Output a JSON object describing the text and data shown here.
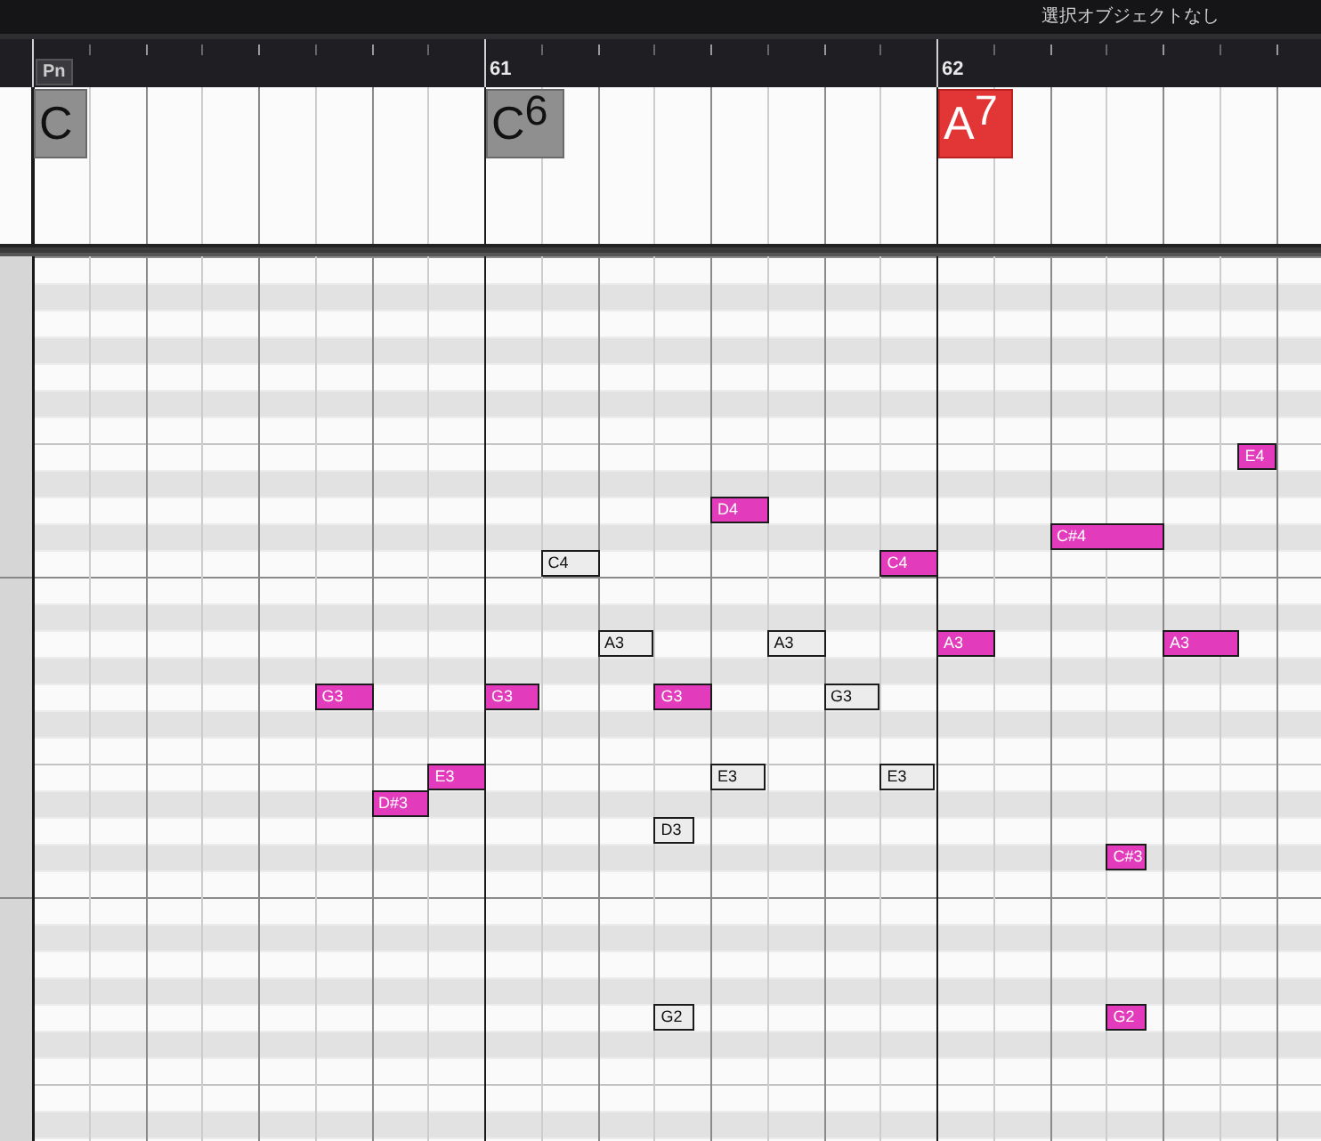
{
  "toolbar": {
    "status_text": "選択オブジェクトなし"
  },
  "ruler": {
    "marker": "Pn",
    "bars": [
      {
        "label": "61"
      },
      {
        "label": "62"
      }
    ]
  },
  "chord_track": {
    "chords": [
      {
        "label": "C",
        "selected": false
      },
      {
        "label": "C$^{6}$",
        "selected": false
      },
      {
        "label": "A$^{7}$",
        "selected": true
      }
    ]
  },
  "notes": [
    {
      "label": "E4",
      "selected": true
    },
    {
      "label": "D4",
      "selected": true
    },
    {
      "label": "C#4",
      "selected": true
    },
    {
      "label": "C4",
      "selected": false
    },
    {
      "label": "C4",
      "selected": true
    },
    {
      "label": "A3",
      "selected": false
    },
    {
      "label": "A3",
      "selected": false
    },
    {
      "label": "A3",
      "selected": true
    },
    {
      "label": "A3",
      "selected": true
    },
    {
      "label": "G3",
      "selected": true
    },
    {
      "label": "G3",
      "selected": true
    },
    {
      "label": "G3",
      "selected": true
    },
    {
      "label": "G3",
      "selected": false
    },
    {
      "label": "E3",
      "selected": true
    },
    {
      "label": "E3",
      "selected": false
    },
    {
      "label": "E3",
      "selected": false
    },
    {
      "label": "D#3",
      "selected": true
    },
    {
      "label": "D3",
      "selected": false
    },
    {
      "label": "C#3",
      "selected": true
    },
    {
      "label": "G2",
      "selected": false
    },
    {
      "label": "G2",
      "selected": true
    }
  ]
}
